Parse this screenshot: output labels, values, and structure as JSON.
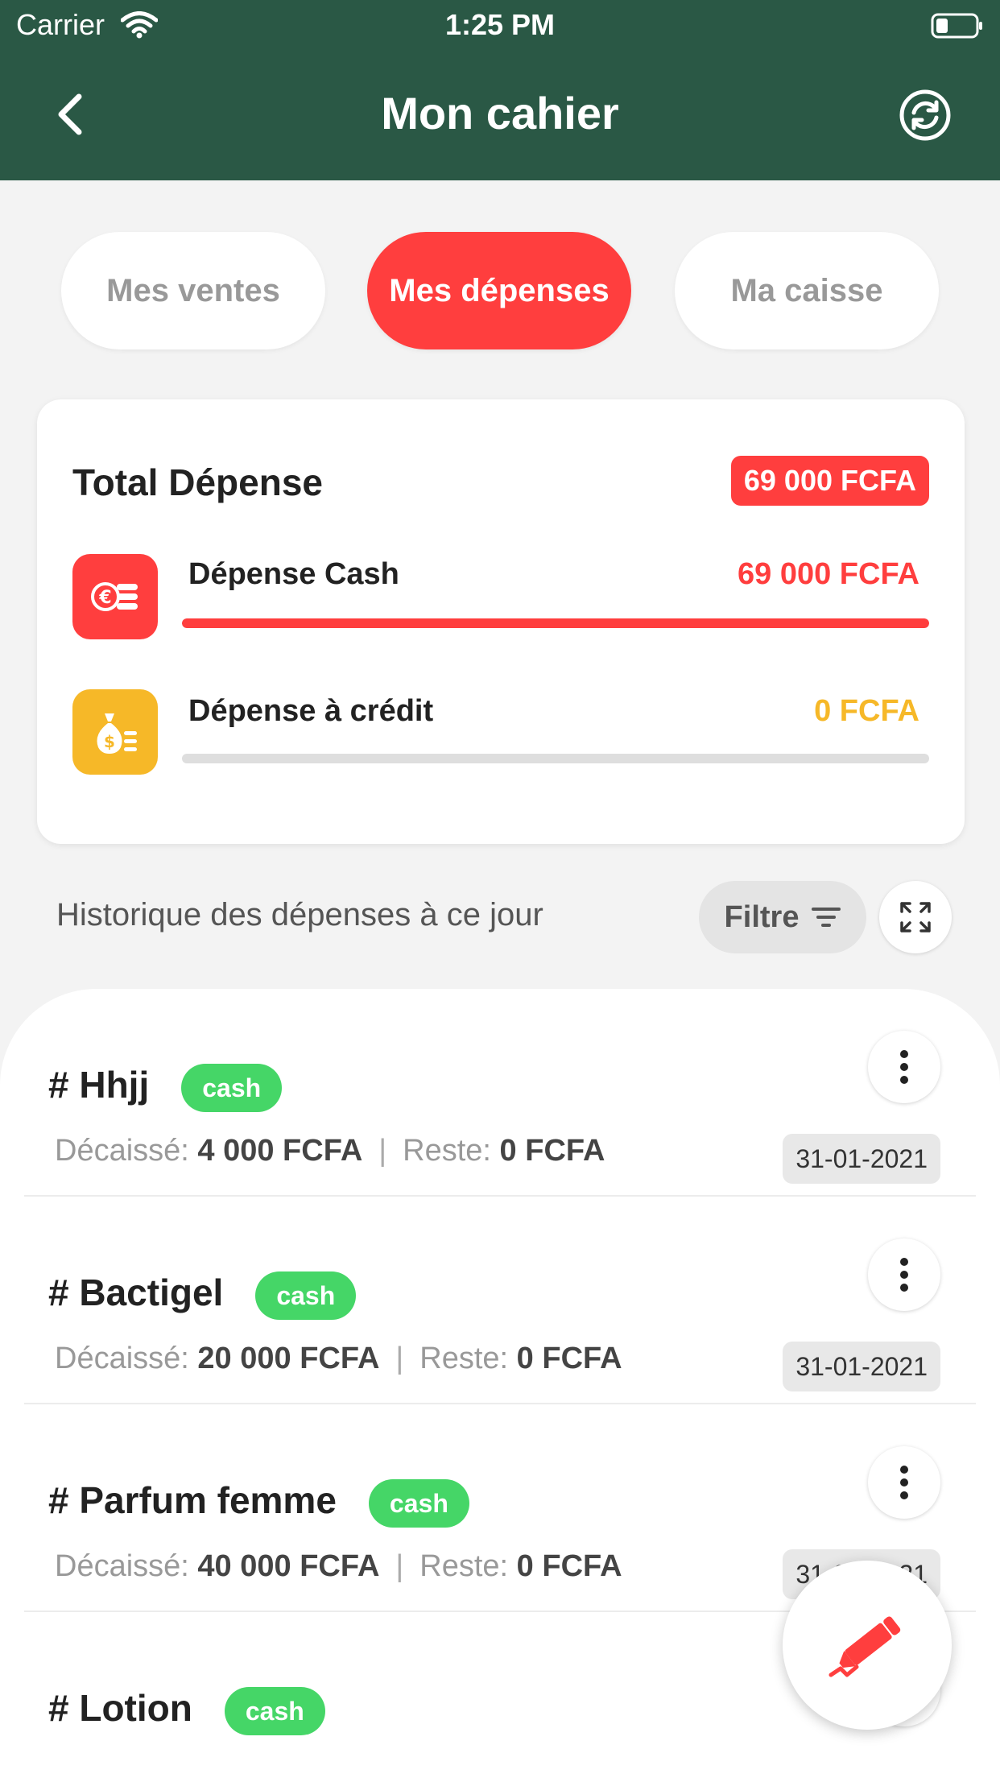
{
  "status_bar": {
    "carrier": "Carrier",
    "time": "1:25 PM",
    "wifi_icon": "wifi-icon",
    "battery_icon": "battery-icon"
  },
  "header": {
    "title": "Mon cahier",
    "back_icon": "chevron-left-icon",
    "refresh_icon": "refresh-icon",
    "background_color": "#2a5845"
  },
  "tabs": [
    {
      "label": "Mes ventes",
      "active": false
    },
    {
      "label": "Mes dépenses",
      "active": true
    },
    {
      "label": "Ma caisse",
      "active": false
    }
  ],
  "summary": {
    "title": "Total Dépense",
    "total": "69 000 FCFA",
    "rows": [
      {
        "label": "Dépense Cash",
        "value": "69 000 FCFA",
        "icon": "coins-icon",
        "color": "#ff3e3e",
        "progress": 1.0
      },
      {
        "label": "Dépense à crédit",
        "value": "0 FCFA",
        "icon": "money-bag-icon",
        "color": "#f6b828",
        "progress": 0.0
      }
    ]
  },
  "history": {
    "title": "Historique des dépenses à ce jour",
    "filter_label": "Filtre",
    "filter_icon": "filter-icon",
    "expand_icon": "expand-icon"
  },
  "expenses": [
    {
      "name": "# Hhjj",
      "badge": "cash",
      "disbursed_label": "Décaissé:",
      "disbursed": "4 000 FCFA",
      "remaining_label": "Reste:",
      "remaining": "0 FCFA",
      "date": "31-01-2021"
    },
    {
      "name": "# Bactigel",
      "badge": "cash",
      "disbursed_label": "Décaissé:",
      "disbursed": "20 000 FCFA",
      "remaining_label": "Reste:",
      "remaining": "0 FCFA",
      "date": "31-01-2021"
    },
    {
      "name": "# Parfum femme",
      "badge": "cash",
      "disbursed_label": "Décaissé:",
      "disbursed": "40 000 FCFA",
      "remaining_label": "Reste:",
      "remaining": "0 FCFA",
      "date": "31-01-2021"
    },
    {
      "name": "# Lotion",
      "badge": "cash"
    }
  ],
  "fab": {
    "icon": "pencil-icon"
  },
  "colors": {
    "accent_red": "#ff3e3e",
    "cash_green": "#45d667",
    "credit_yellow": "#f6b828"
  }
}
